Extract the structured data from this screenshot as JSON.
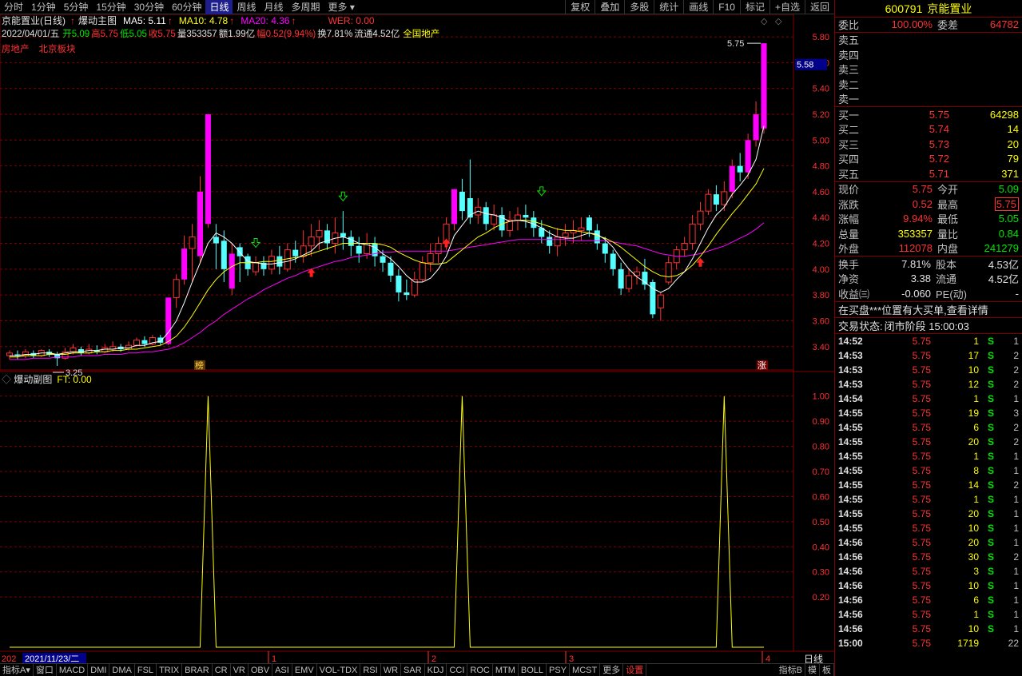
{
  "toolbar": {
    "timeframes": [
      "分时",
      "1分钟",
      "5分钟",
      "15分钟",
      "30分钟",
      "60分钟",
      "日线",
      "周线",
      "月线",
      "多周期",
      "更多"
    ],
    "active_timeframe": "日线",
    "buttons": [
      "复权",
      "叠加",
      "多股",
      "统计",
      "画线",
      "F10",
      "标记",
      "+自选",
      "返回"
    ]
  },
  "main": {
    "title": "京能置业(日线)",
    "indicator": "爆动主图",
    "ma5": "MA5: 5.11",
    "ma10": "MA10: 4.78",
    "ma20": "MA20: 4.36",
    "wer": "WER: 0.00",
    "info_date": "2022/04/01/五",
    "info_open": "开5.09",
    "info_high": "高5.75",
    "info_low": "低5.05",
    "info_close": "收5.75",
    "info_vol": "量353357",
    "info_amt": "额1.99亿",
    "info_pct": "幅0.52(9.94%)",
    "info_turn": "换7.81%",
    "info_float": "流通4.52亿",
    "info_sector": "全国地产",
    "tag1": "房地产",
    "tag2": "北京板块",
    "price_badge": "5.58",
    "label_high": "5.75",
    "label_low": "3.25",
    "mark_bang": "榜",
    "mark_zhang": "涨",
    "colors": {
      "up": "#ff00ff",
      "down": "#55ffff",
      "ma5": "#ffffff",
      "ma10": "#ffff00",
      "ma20": "#ff00ff",
      "grid": "#800000",
      "axis": "#ff3232"
    }
  },
  "sub": {
    "title": "爆动副图",
    "ft": "FT: 0.00"
  },
  "xaxis": {
    "date_label": "2021/11/23/二",
    "prefix": "202",
    "months": [
      "1",
      "2",
      "3",
      "4"
    ],
    "period": "日线"
  },
  "bottom": {
    "tabs": [
      "指标A",
      "窗口",
      "MACD",
      "DMI",
      "DMA",
      "FSL",
      "TRIX",
      "BRAR",
      "CR",
      "VR",
      "OBV",
      "ASI",
      "EMV",
      "VOL-TDX",
      "RSI",
      "WR",
      "SAR",
      "KDJ",
      "CCI",
      "ROC",
      "MTM",
      "BOLL",
      "PSY",
      "MCST",
      "更多",
      "设置"
    ],
    "active_tab": "设置",
    "right": [
      "指标B",
      "模",
      "板"
    ]
  },
  "chart_data": [
    {
      "type": "candlestick",
      "title": "京能置业(日线)",
      "ylim": [
        3.25,
        5.85
      ],
      "yticks": [
        3.4,
        3.6,
        3.8,
        4.0,
        4.2,
        4.4,
        4.6,
        4.8,
        5.0,
        5.2,
        5.4,
        5.6,
        5.8
      ],
      "candles": [
        [
          3.33,
          3.35,
          3.3,
          3.37
        ],
        [
          3.34,
          3.33,
          3.3,
          3.37
        ],
        [
          3.33,
          3.36,
          3.31,
          3.38
        ],
        [
          3.35,
          3.33,
          3.31,
          3.37
        ],
        [
          3.33,
          3.37,
          3.32,
          3.38
        ],
        [
          3.36,
          3.34,
          3.32,
          3.38
        ],
        [
          3.34,
          3.31,
          3.25,
          3.36
        ],
        [
          3.31,
          3.36,
          3.3,
          3.39
        ],
        [
          3.36,
          3.39,
          3.34,
          3.42
        ],
        [
          3.38,
          3.35,
          3.33,
          3.4
        ],
        [
          3.35,
          3.38,
          3.34,
          3.42
        ],
        [
          3.37,
          3.36,
          3.34,
          3.41
        ],
        [
          3.36,
          3.39,
          3.35,
          3.42
        ],
        [
          3.38,
          3.4,
          3.36,
          3.44
        ],
        [
          3.4,
          3.38,
          3.36,
          3.42
        ],
        [
          3.38,
          3.41,
          3.37,
          3.44
        ],
        [
          3.41,
          3.45,
          3.4,
          3.47
        ],
        [
          3.45,
          3.42,
          3.4,
          3.48
        ],
        [
          3.42,
          3.47,
          3.41,
          3.49
        ],
        [
          3.47,
          3.43,
          3.41,
          3.49
        ],
        [
          3.42,
          3.78,
          3.41,
          3.78
        ],
        [
          3.78,
          3.92,
          3.7,
          3.96
        ],
        [
          3.92,
          4.16,
          3.88,
          4.26
        ],
        [
          4.16,
          4.25,
          3.9,
          4.35
        ],
        [
          4.1,
          4.6,
          4.05,
          4.72
        ],
        [
          4.35,
          5.2,
          4.32,
          5.2
        ],
        [
          4.25,
          4.2,
          4.0,
          4.35
        ],
        [
          4.22,
          4.0,
          3.9,
          4.3
        ],
        [
          3.85,
          4.12,
          3.8,
          4.2
        ],
        [
          4.17,
          4.1,
          3.9,
          4.2
        ],
        [
          4.1,
          4.0,
          3.95,
          4.12
        ],
        [
          3.98,
          4.05,
          3.95,
          4.1
        ],
        [
          4.05,
          4.0,
          3.95,
          4.1
        ],
        [
          4.0,
          4.1,
          3.96,
          4.15
        ],
        [
          4.1,
          4.02,
          3.96,
          4.18
        ],
        [
          4.0,
          4.15,
          3.98,
          4.2
        ],
        [
          4.15,
          4.1,
          4.05,
          4.22
        ],
        [
          4.1,
          4.18,
          4.05,
          4.3
        ],
        [
          4.18,
          4.25,
          4.1,
          4.35
        ],
        [
          4.25,
          4.3,
          4.15,
          4.38
        ],
        [
          4.3,
          4.2,
          4.15,
          4.35
        ],
        [
          4.2,
          4.28,
          4.12,
          4.4
        ],
        [
          4.28,
          4.25,
          4.15,
          4.45
        ],
        [
          4.25,
          4.18,
          4.1,
          4.3
        ],
        [
          4.18,
          4.12,
          4.05,
          4.25
        ],
        [
          4.12,
          4.2,
          4.08,
          4.28
        ],
        [
          4.2,
          4.1,
          4.02,
          4.25
        ],
        [
          4.1,
          4.05,
          3.98,
          4.15
        ],
        [
          4.05,
          3.95,
          3.9,
          4.1
        ],
        [
          3.95,
          3.82,
          3.75,
          4.0
        ],
        [
          3.82,
          3.8,
          3.76,
          3.92
        ],
        [
          3.8,
          3.92,
          3.78,
          3.98
        ],
        [
          3.92,
          4.05,
          3.9,
          4.1
        ],
        [
          4.05,
          4.12,
          3.98,
          4.2
        ],
        [
          4.12,
          4.2,
          4.05,
          4.25
        ],
        [
          4.2,
          4.35,
          4.15,
          4.4
        ],
        [
          4.35,
          4.62,
          4.3,
          4.62
        ],
        [
          4.6,
          4.45,
          4.38,
          4.7
        ],
        [
          4.55,
          4.4,
          4.35,
          4.85
        ],
        [
          4.42,
          4.48,
          4.35,
          4.55
        ],
        [
          4.48,
          4.35,
          4.3,
          4.52
        ],
        [
          4.35,
          4.42,
          4.3,
          4.5
        ],
        [
          4.42,
          4.3,
          4.25,
          4.48
        ],
        [
          4.3,
          4.38,
          4.25,
          4.45
        ],
        [
          4.38,
          4.42,
          4.3,
          4.48
        ],
        [
          4.42,
          4.4,
          4.32,
          4.5
        ],
        [
          4.4,
          4.32,
          4.25,
          4.45
        ],
        [
          4.32,
          4.25,
          4.2,
          4.38
        ],
        [
          4.25,
          4.18,
          4.12,
          4.3
        ],
        [
          4.18,
          4.25,
          4.1,
          4.32
        ],
        [
          4.25,
          4.28,
          4.18,
          4.35
        ],
        [
          4.28,
          4.3,
          4.2,
          4.38
        ],
        [
          4.3,
          4.32,
          4.22,
          4.4
        ],
        [
          4.4,
          4.3,
          4.25,
          4.42
        ],
        [
          4.3,
          4.2,
          4.15,
          4.35
        ],
        [
          4.2,
          4.12,
          4.05,
          4.25
        ],
        [
          4.12,
          4.0,
          3.95,
          4.15
        ],
        [
          4.0,
          3.85,
          3.8,
          4.05
        ],
        [
          3.85,
          3.95,
          3.82,
          4.0
        ],
        [
          3.95,
          3.98,
          3.88,
          4.02
        ],
        [
          3.98,
          3.88,
          3.84,
          4.08
        ],
        [
          3.9,
          3.65,
          3.62,
          3.92
        ],
        [
          3.7,
          3.8,
          3.6,
          3.82
        ],
        [
          3.9,
          4.05,
          3.88,
          4.1
        ],
        [
          4.05,
          4.15,
          4.0,
          4.18
        ],
        [
          4.15,
          4.2,
          4.1,
          4.25
        ],
        [
          4.2,
          4.35,
          4.15,
          4.42
        ],
        [
          4.35,
          4.45,
          4.3,
          4.52
        ],
        [
          4.45,
          4.58,
          4.42,
          4.62
        ],
        [
          4.58,
          4.5,
          4.45,
          4.65
        ],
        [
          4.5,
          4.6,
          4.45,
          4.68
        ],
        [
          4.6,
          4.8,
          4.55,
          4.85
        ],
        [
          4.8,
          4.75,
          4.68,
          4.9
        ],
        [
          4.75,
          5.0,
          4.7,
          5.05
        ],
        [
          5.0,
          5.2,
          4.95,
          5.3
        ],
        [
          5.09,
          5.75,
          5.05,
          5.75
        ]
      ],
      "ma5": [
        3.33,
        3.33,
        3.34,
        3.34,
        3.35,
        3.35,
        3.34,
        3.35,
        3.36,
        3.36,
        3.37,
        3.37,
        3.38,
        3.38,
        3.39,
        3.39,
        3.41,
        3.41,
        3.43,
        3.44,
        3.51,
        3.6,
        3.74,
        3.9,
        4.05,
        4.2,
        4.28,
        4.25,
        4.2,
        4.13,
        4.06,
        4.05,
        4.04,
        4.04,
        4.05,
        4.06,
        4.08,
        4.11,
        4.14,
        4.2,
        4.22,
        4.24,
        4.25,
        4.23,
        4.2,
        4.19,
        4.17,
        4.12,
        4.08,
        4.02,
        3.95,
        3.9,
        3.9,
        3.93,
        4.0,
        4.1,
        4.26,
        4.34,
        4.42,
        4.45,
        4.43,
        4.42,
        4.4,
        4.37,
        4.38,
        4.37,
        4.35,
        4.32,
        4.28,
        4.25,
        4.24,
        4.24,
        4.26,
        4.28,
        4.27,
        4.23,
        4.17,
        4.08,
        4.0,
        3.94,
        3.9,
        3.85,
        3.82,
        3.85,
        3.92,
        3.98,
        4.08,
        4.2,
        4.32,
        4.42,
        4.48,
        4.58,
        4.65,
        4.73,
        4.85,
        5.11
      ],
      "ma10": [
        3.32,
        3.32,
        3.33,
        3.33,
        3.33,
        3.34,
        3.34,
        3.34,
        3.35,
        3.35,
        3.35,
        3.36,
        3.36,
        3.37,
        3.37,
        3.38,
        3.38,
        3.39,
        3.4,
        3.41,
        3.44,
        3.48,
        3.55,
        3.64,
        3.74,
        3.84,
        3.92,
        3.98,
        4.02,
        4.05,
        4.05,
        4.05,
        4.06,
        4.06,
        4.07,
        4.08,
        4.09,
        4.1,
        4.12,
        4.14,
        4.16,
        4.18,
        4.2,
        4.2,
        4.2,
        4.2,
        4.2,
        4.19,
        4.17,
        4.13,
        4.1,
        4.07,
        4.05,
        4.04,
        4.04,
        4.05,
        4.1,
        4.15,
        4.2,
        4.25,
        4.28,
        4.32,
        4.35,
        4.37,
        4.38,
        4.38,
        4.37,
        4.35,
        4.33,
        4.31,
        4.3,
        4.3,
        4.29,
        4.28,
        4.26,
        4.24,
        4.21,
        4.17,
        4.12,
        4.07,
        4.02,
        3.98,
        3.95,
        3.94,
        3.95,
        3.98,
        4.03,
        4.1,
        4.18,
        4.27,
        4.35,
        4.43,
        4.5,
        4.58,
        4.66,
        4.78
      ],
      "ma20": [
        3.3,
        3.3,
        3.3,
        3.31,
        3.31,
        3.31,
        3.32,
        3.32,
        3.32,
        3.33,
        3.33,
        3.33,
        3.34,
        3.34,
        3.34,
        3.35,
        3.35,
        3.36,
        3.36,
        3.37,
        3.38,
        3.4,
        3.43,
        3.47,
        3.51,
        3.56,
        3.6,
        3.65,
        3.69,
        3.73,
        3.77,
        3.8,
        3.84,
        3.87,
        3.9,
        3.93,
        3.95,
        3.98,
        4.0,
        4.02,
        4.04,
        4.06,
        4.07,
        4.09,
        4.1,
        4.11,
        4.12,
        4.13,
        4.13,
        4.14,
        4.14,
        4.14,
        4.14,
        4.14,
        4.14,
        4.14,
        4.15,
        4.16,
        4.17,
        4.18,
        4.19,
        4.2,
        4.21,
        4.22,
        4.23,
        4.23,
        4.23,
        4.23,
        4.23,
        4.23,
        4.23,
        4.22,
        4.22,
        4.22,
        4.22,
        4.22,
        4.21,
        4.2,
        4.19,
        4.18,
        4.16,
        4.14,
        4.12,
        4.11,
        4.1,
        4.1,
        4.11,
        4.12,
        4.14,
        4.16,
        4.18,
        4.21,
        4.24,
        4.27,
        4.31,
        4.36
      ]
    },
    {
      "type": "line",
      "title": "爆动副图",
      "ylim": [
        0,
        1.05
      ],
      "yticks": [
        0.2,
        0.3,
        0.4,
        0.5,
        0.6,
        0.7,
        0.8,
        0.9,
        1.0
      ],
      "spikes_at_index": [
        25,
        57,
        90
      ],
      "series": [
        {
          "name": "FT",
          "color": "#ffff00"
        }
      ]
    }
  ],
  "quote": {
    "code": "600791",
    "name": "京能置业",
    "wb_label": "委比",
    "wb_value": "100.00%",
    "wc_label": "委差",
    "wc_value": "64782",
    "asks": [
      {
        "label": "卖五",
        "price": "",
        "vol": ""
      },
      {
        "label": "卖四",
        "price": "",
        "vol": ""
      },
      {
        "label": "卖三",
        "price": "",
        "vol": ""
      },
      {
        "label": "卖二",
        "price": "",
        "vol": ""
      },
      {
        "label": "卖一",
        "price": "",
        "vol": ""
      }
    ],
    "bids": [
      {
        "label": "买一",
        "price": "5.75",
        "vol": "64298"
      },
      {
        "label": "买二",
        "price": "5.74",
        "vol": "14"
      },
      {
        "label": "买三",
        "price": "5.73",
        "vol": "20"
      },
      {
        "label": "买四",
        "price": "5.72",
        "vol": "79"
      },
      {
        "label": "买五",
        "price": "5.71",
        "vol": "371"
      }
    ],
    "stats": [
      {
        "l1": "现价",
        "v1": "5.75",
        "c1": "red",
        "l2": "今开",
        "v2": "5.09",
        "c2": "green"
      },
      {
        "l1": "涨跌",
        "v1": "0.52",
        "c1": "red",
        "l2": "最高",
        "v2": "5.75",
        "c2": "red"
      },
      {
        "l1": "涨幅",
        "v1": "9.94%",
        "c1": "red",
        "l2": "最低",
        "v2": "5.05",
        "c2": "green"
      },
      {
        "l1": "总量",
        "v1": "353357",
        "c1": "yellow",
        "l2": "量比",
        "v2": "0.84",
        "c2": "green"
      },
      {
        "l1": "外盘",
        "v1": "112078",
        "c1": "red",
        "l2": "内盘",
        "v2": "241279",
        "c2": "green"
      }
    ],
    "fin": [
      {
        "l1": "换手",
        "v1": "7.81%",
        "l2": "股本",
        "v2": "4.53亿"
      },
      {
        "l1": "净资",
        "v1": "3.38",
        "l2": "流通",
        "v2": "4.52亿"
      },
      {
        "l1": "收益㈢",
        "v1": "-0.060",
        "l2": "PE(动)",
        "v2": "-"
      }
    ],
    "banner1": "在买盘***位置有大买单,查看详情",
    "banner2_label": "交易状态:",
    "banner2_value": "闭市阶段 15:00:03",
    "ticks": [
      [
        "14:52",
        "5.75",
        "1",
        "S",
        "1"
      ],
      [
        "14:53",
        "5.75",
        "17",
        "S",
        "2"
      ],
      [
        "14:53",
        "5.75",
        "10",
        "S",
        "2"
      ],
      [
        "14:53",
        "5.75",
        "12",
        "S",
        "2"
      ],
      [
        "14:54",
        "5.75",
        "1",
        "S",
        "1"
      ],
      [
        "14:55",
        "5.75",
        "19",
        "S",
        "3"
      ],
      [
        "14:55",
        "5.75",
        "6",
        "S",
        "2"
      ],
      [
        "14:55",
        "5.75",
        "20",
        "S",
        "2"
      ],
      [
        "14:55",
        "5.75",
        "1",
        "S",
        "1"
      ],
      [
        "14:55",
        "5.75",
        "8",
        "S",
        "1"
      ],
      [
        "14:55",
        "5.75",
        "14",
        "S",
        "2"
      ],
      [
        "14:55",
        "5.75",
        "1",
        "S",
        "1"
      ],
      [
        "14:55",
        "5.75",
        "20",
        "S",
        "1"
      ],
      [
        "14:55",
        "5.75",
        "10",
        "S",
        "1"
      ],
      [
        "14:56",
        "5.75",
        "20",
        "S",
        "1"
      ],
      [
        "14:56",
        "5.75",
        "30",
        "S",
        "2"
      ],
      [
        "14:56",
        "5.75",
        "3",
        "S",
        "1"
      ],
      [
        "14:56",
        "5.75",
        "10",
        "S",
        "1"
      ],
      [
        "14:56",
        "5.75",
        "6",
        "S",
        "1"
      ],
      [
        "14:56",
        "5.75",
        "1",
        "S",
        "1"
      ],
      [
        "14:56",
        "5.75",
        "10",
        "S",
        "1"
      ],
      [
        "15:00",
        "5.75",
        "1719",
        "",
        "22"
      ]
    ]
  }
}
